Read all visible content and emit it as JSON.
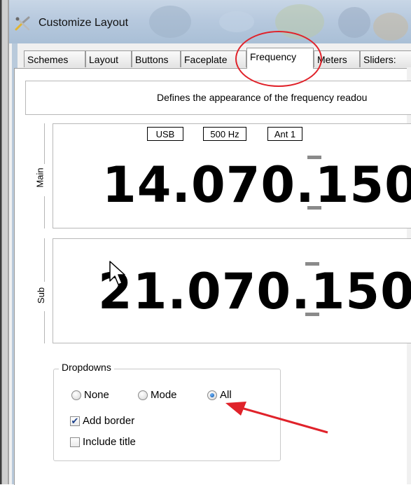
{
  "window": {
    "title": "Customize Layout"
  },
  "tabs": [
    "Schemes",
    "Layout",
    "Buttons",
    "Faceplate",
    "Frequency",
    "Meters",
    "Sliders:"
  ],
  "active_tab": "Frequency",
  "description": "Defines the appearance of the frequency readou",
  "main": {
    "label": "Main",
    "mode": "USB",
    "filter": "500 Hz",
    "antenna": "Ant 1",
    "frequency": "14.070.150"
  },
  "sub": {
    "label": "Sub",
    "frequency": "21.070.150"
  },
  "dropdowns": {
    "title": "Dropdowns",
    "options": [
      "None",
      "Mode",
      "All"
    ],
    "selected": "All",
    "add_border_label": "Add border",
    "add_border_checked": true,
    "include_title_label": "Include title",
    "include_title_checked": false
  },
  "colors": {
    "annotation": "#e0222a",
    "tuning_tick": "#8a8a8a"
  }
}
